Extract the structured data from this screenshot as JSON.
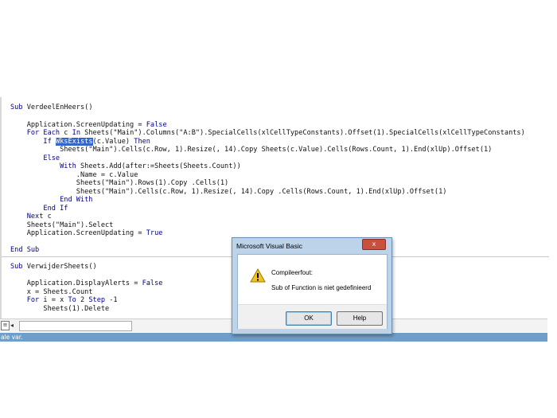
{
  "editor": {
    "lines": [
      "Sub VerdeelEnHeers()",
      "",
      "    Application.ScreenUpdating = False",
      "    For Each c In Sheets(\"Main\").Columns(\"A:B\").SpecialCells(xlCellTypeConstants).Offset(1).SpecialCells(xlCellTypeConstants)",
      "        If WksExists(c.Value) Then",
      "            Sheets(\"Main\").Cells(c.Row, 1).Resize(, 14).Copy Sheets(c.Value).Cells(Rows.Count, 1).End(xlUp).Offset(1)",
      "        Else",
      "            With Sheets.Add(after:=Sheets(Sheets.Count))",
      "                .Name = c.Value",
      "                Sheets(\"Main\").Rows(1).Copy .Cells(1)",
      "                Sheets(\"Main\").Cells(c.Row, 1).Resize(, 14).Copy .Cells(Rows.Count, 1).End(xlUp).Offset(1)",
      "            End With",
      "        End If",
      "    Next c",
      "    Sheets(\"Main\").Select",
      "    Application.ScreenUpdating = True",
      "",
      "End Sub",
      "",
      "Sub VerwijderSheets()",
      "",
      "    Application.DisplayAlerts = False",
      "    x = Sheets.Count",
      "    For i = x To 2 Step -1",
      "        Sheets(1).Delete"
    ],
    "selected_text": "WksExists",
    "highlight_color": "#3366cc"
  },
  "status_bar": {
    "text": "ale var."
  },
  "dialog": {
    "title": "Microsoft Visual Basic",
    "close_label": "x",
    "heading": "Compileerfout:",
    "message": "Sub of Function is niet gedefinieerd",
    "ok_label": "OK",
    "help_label": "Help",
    "icon": "warning-icon"
  }
}
